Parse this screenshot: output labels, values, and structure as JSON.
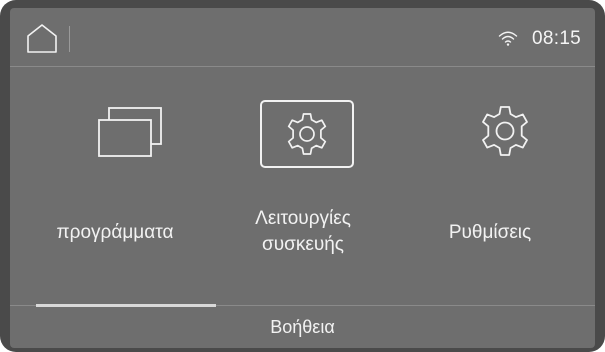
{
  "status_bar": {
    "home_icon": "home-icon",
    "wifi_icon": "wifi-icon",
    "time": "08:15"
  },
  "tiles": [
    {
      "id": "programs",
      "label": "προγράμματα",
      "icon": "programs-windows-icon",
      "selected": false
    },
    {
      "id": "functions",
      "label_line1": "Λειτουργίες",
      "label_line2": "συσκευής",
      "icon": "gear-in-frame-icon",
      "selected": true
    },
    {
      "id": "settings",
      "label": "Ρυθμίσεις",
      "icon": "gear-icon",
      "selected": false
    }
  ],
  "bottom_bar": {
    "help_label": "Βοήθεια"
  },
  "colors": {
    "bezel": "#4a4a4a",
    "screen": "#6e6e6e",
    "foreground": "#f2f2f2",
    "divider": "#8a8a8a"
  }
}
